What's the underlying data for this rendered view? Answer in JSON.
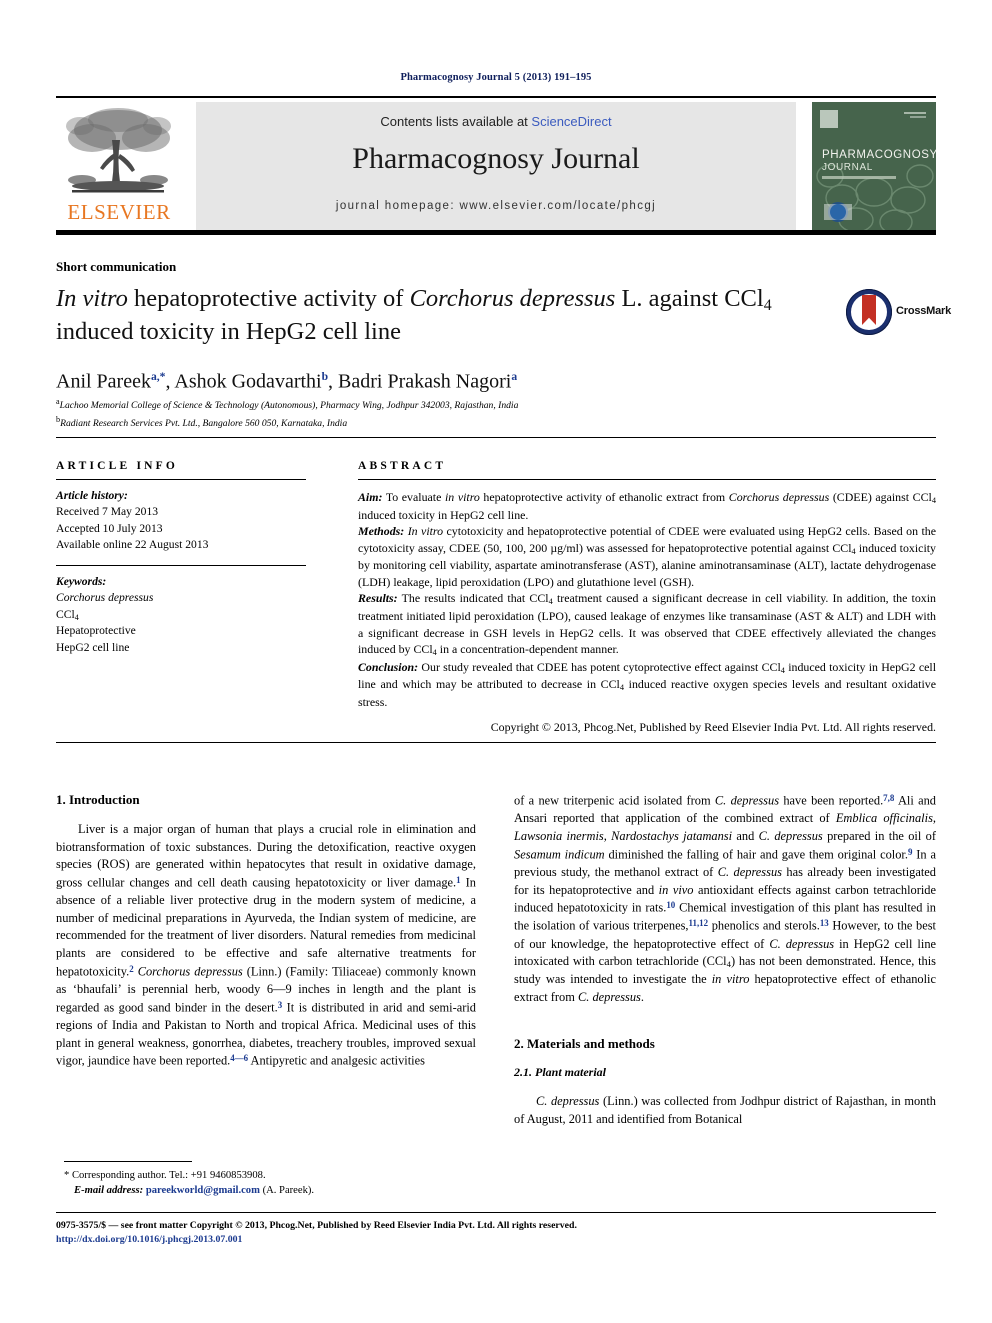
{
  "running_head": "Pharmacognosy Journal 5 (2013) 191–195",
  "masthead": {
    "publisher_name": "ELSEVIER",
    "contents_prefix": "Contents lists available at ",
    "contents_link": "ScienceDirect",
    "journal_name": "Pharmacognosy Journal",
    "homepage": "journal homepage: www.elsevier.com/locate/phcgj",
    "cover_title_line1": "PHARMACOGNOSY",
    "cover_title_line2": "JOURNAL"
  },
  "article": {
    "doctype": "Short communication",
    "title_part1": "In vitro",
    "title_part2": " hepatoprotective activity of ",
    "title_part3": "Corchorus depressus",
    "title_part4": " L. against CCl",
    "title_sub": "4",
    "title_part5": " induced toxicity in HepG2 cell line",
    "crossmark_label": "CrossMark",
    "authors": [
      {
        "name": "Anil Pareek",
        "marks": "a,*"
      },
      {
        "name": "Ashok Godavarthi",
        "marks": "b"
      },
      {
        "name": "Badri Prakash Nagori",
        "marks": "a"
      }
    ],
    "affiliations": [
      {
        "mark": "a",
        "text": "Lachoo Memorial College of Science & Technology (Autonomous), Pharmacy Wing, Jodhpur 342003, Rajasthan, India"
      },
      {
        "mark": "b",
        "text": "Radiant Research Services Pvt. Ltd., Bangalore 560 050, Karnataka, India"
      }
    ]
  },
  "info": {
    "heading": "ARTICLE INFO",
    "history_label": "Article history:",
    "history": [
      "Received 7 May 2013",
      "Accepted 10 July 2013",
      "Available online 22 August 2013"
    ],
    "keywords_label": "Keywords:",
    "keywords": [
      "Corchorus depressus",
      "CCl4",
      "Hepatoprotective",
      "HepG2 cell line"
    ]
  },
  "abstract": {
    "heading": "ABSTRACT",
    "aim_label": "Aim:",
    "aim_text": " To evaluate in vitro hepatoprotective activity of ethanolic extract from Corchorus depressus (CDEE) against CCl4 induced toxicity in HepG2 cell line.",
    "methods_label": "Methods:",
    "methods_text": " In vitro cytotoxicity and hepatoprotective potential of CDEE were evaluated using HepG2 cells. Based on the cytotoxicity assay, CDEE (50, 100, 200 µg/ml) was assessed for hepatoprotective potential against CCl4 induced toxicity by monitoring cell viability, aspartate aminotransferase (AST), alanine aminotransaminase (ALT), lactate dehydrogenase (LDH) leakage, lipid peroxidation (LPO) and glutathione level (GSH).",
    "results_label": "Results:",
    "results_text": " The results indicated that CCl4 treatment caused a significant decrease in cell viability. In addition, the toxin treatment initiated lipid peroxidation (LPO), caused leakage of enzymes like transaminase (AST & ALT) and LDH with a significant decrease in GSH levels in HepG2 cells. It was observed that CDEE effectively alleviated the changes induced by CCl4 in a concentration-dependent manner.",
    "conclusion_label": "Conclusion:",
    "conclusion_text": " Our study revealed that CDEE has potent cytoprotective effect against CCl4 induced toxicity in HepG2 cell line and which may be attributed to decrease in CCl4 induced reactive oxygen species levels and resultant oxidative stress.",
    "copyright": "Copyright © 2013, Phcog.Net, Published by Reed Elsevier India Pvt. Ltd. All rights reserved."
  },
  "body": {
    "intro_heading": "1.  Introduction",
    "intro_p1_a": "Liver is a major organ of human that plays a crucial role in elimination and biotransformation of toxic substances. During the detoxification, reactive oxygen species (ROS) are generated within hepatocytes that result in oxidative damage, gross cellular changes and cell death causing hepatotoxicity or liver damage.",
    "intro_p1_r1": "1",
    "intro_p1_b": " In absence of a reliable liver protective drug in the modern system of medicine, a number of medicinal preparations in Ayurveda, the Indian system of medicine, are recommended for the treatment of liver disorders. Natural remedies from medicinal plants are considered to be effective and safe alternative treatments for hepatotoxicity.",
    "intro_p1_r2": "2",
    "intro_p1_c_i": "Corchorus depressus",
    "intro_p1_c": " (Linn.) (Family: Tiliaceae) commonly known as ‘bhaufali’ is perennial herb, woody 6—9 inches in length and the plant is regarded as good sand binder in the desert.",
    "intro_p1_r3": "3",
    "intro_p1_d": " It is distributed in arid and semi-arid regions of India and Pakistan to North and tropical Africa. Medicinal uses of this plant in general weakness, gonorrhea, diabetes, treachery troubles, improved sexual vigor, jaundice have been reported.",
    "intro_p1_r4": "4—6",
    "intro_p1_e": " Antipyretic and analgesic activities of a new triterpenic acid isolated from C. depressus have been reported.",
    "intro_p1_r5": "7,8",
    "intro_p1_f": " Ali and Ansari reported that application of the combined extract of ",
    "intro_p1_i1": "Emblica officinalis, Lawsonia inermis, Nardostachys jatamansi",
    "intro_p1_g": " and ",
    "intro_p1_i2": "C. depressus",
    "intro_p1_h": " prepared in the oil of ",
    "intro_p1_i3": "Sesamum indicum",
    "intro_p1_j": " diminished the falling of hair and gave them original color.",
    "intro_p1_r6": "9",
    "intro_p1_k": " In a previous study, the methanol extract of ",
    "intro_p1_i4": "C. depressus",
    "intro_p1_l": " has already been investigated for its hepatoprotective and ",
    "intro_p1_i5": "in vivo",
    "intro_p1_m": " antioxidant effects against carbon tetrachloride induced hepatotoxicity in rats.",
    "intro_p1_r7": "10",
    "intro_p1_n": " Chemical investigation of this plant has resulted in the isolation of various triterpenes,",
    "intro_p1_r8": "11,12",
    "intro_p1_o": " phenolics and sterols.",
    "intro_p1_r9": "13",
    "intro_p1_p": " However, to the best of our knowledge, the hepatoprotective effect of ",
    "intro_p1_i6": "C. depressus",
    "intro_p1_q": " in HepG2 cell line intoxicated with carbon tetrachloride (CCl4) has not been demonstrated. Hence, this study was intended to investigate the ",
    "intro_p1_i7": "in vitro",
    "intro_p1_s": " hepatoprotective effect of ethanolic extract from ",
    "intro_p1_i8": "C. depressus",
    "intro_p1_t": ".",
    "methods_heading": "2.  Materials and methods",
    "plant_heading": "2.1.  Plant material",
    "plant_p1_i": "C. depressus",
    "plant_p1": " (Linn.) was collected from Jodhpur district of Rajasthan, in month of August, 2011 and identified from Botanical"
  },
  "footnote": {
    "star": "*",
    "corresponding": " Corresponding author. Tel.: +91 9460853908.",
    "email_label": "E-mail address:",
    "email": "pareekworld@gmail.com",
    "email_attrib": " (A. Pareek)."
  },
  "bottom": {
    "copyright": "0975-3575/$ — see front matter Copyright © 2013, Phcog.Net, Published by Reed Elsevier India Pvt. Ltd. All rights reserved.",
    "doi": "http://dx.doi.org/10.1016/j.phcgj.2013.07.001"
  }
}
